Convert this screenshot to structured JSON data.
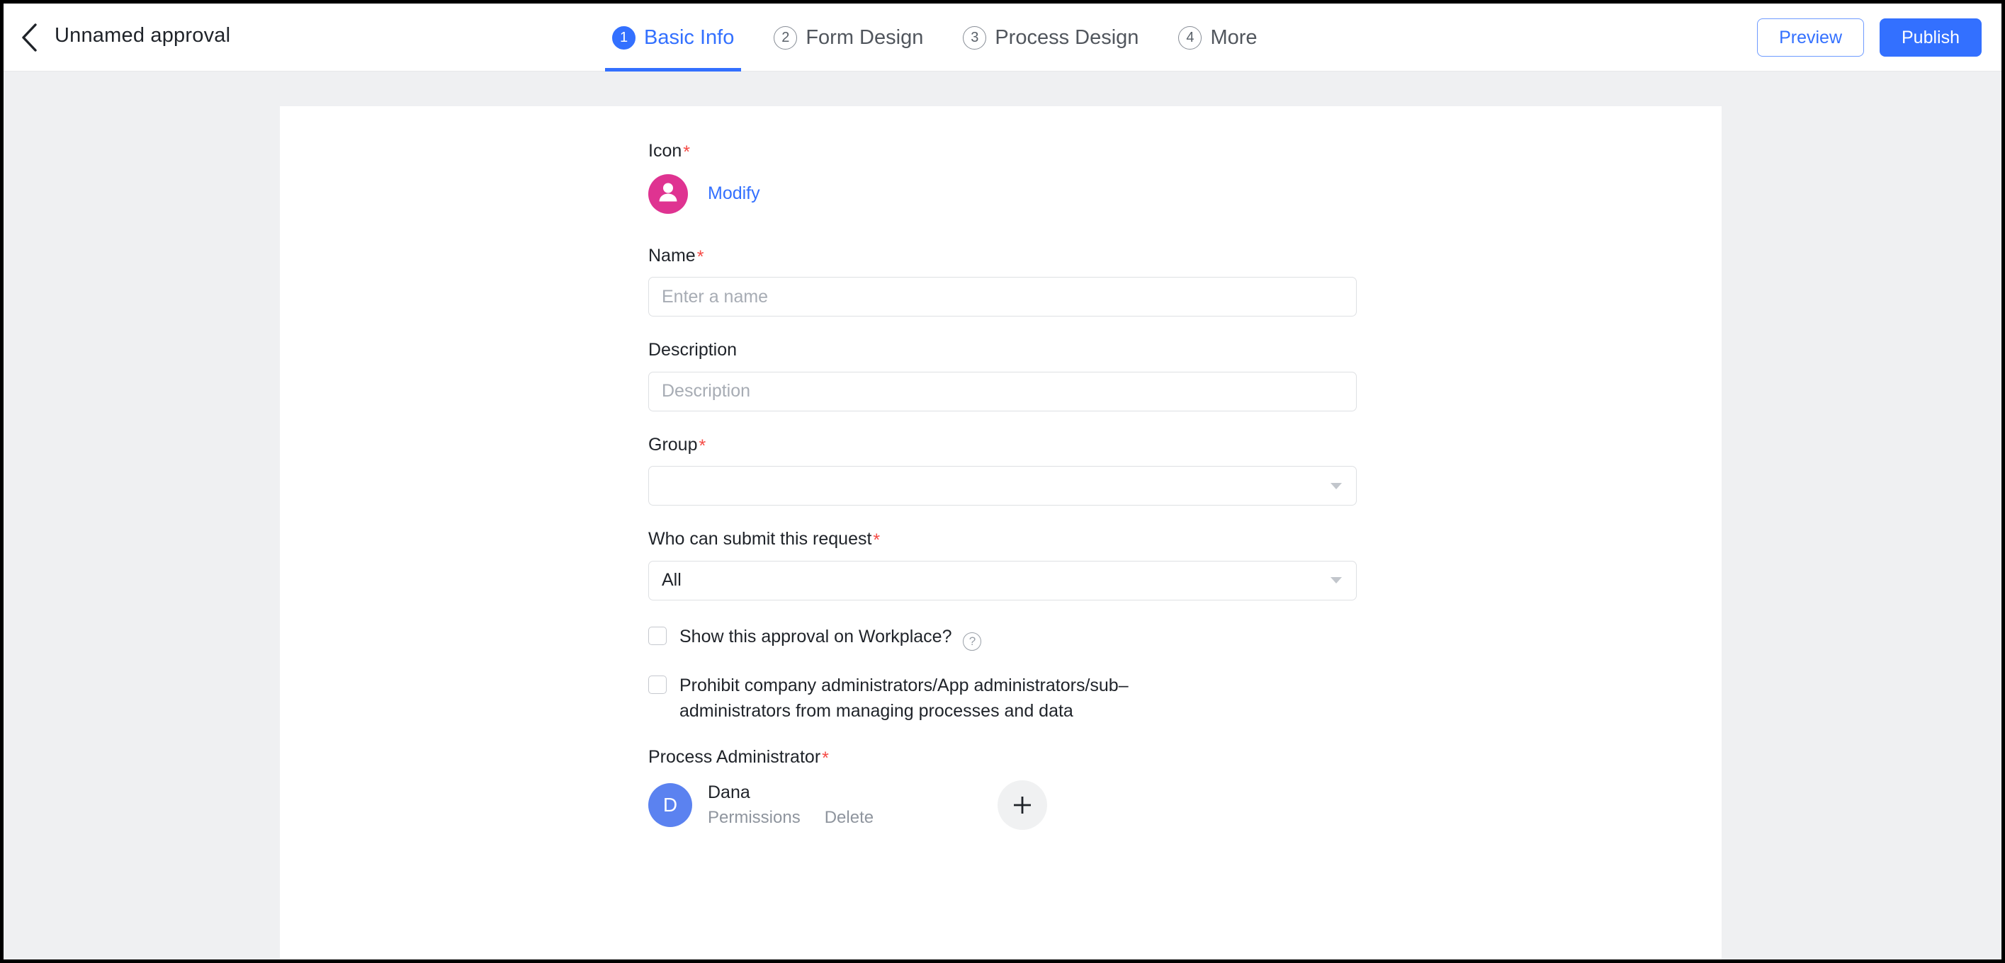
{
  "header": {
    "back_icon": "chevron-left-icon",
    "title": "Unnamed approval",
    "tabs": [
      {
        "num": "1",
        "label": "Basic Info",
        "active": true
      },
      {
        "num": "2",
        "label": "Form Design",
        "active": false
      },
      {
        "num": "3",
        "label": "Process Design",
        "active": false
      },
      {
        "num": "4",
        "label": "More",
        "active": false
      }
    ],
    "preview_label": "Preview",
    "publish_label": "Publish"
  },
  "form": {
    "icon": {
      "label": "Icon",
      "required": "*",
      "glyph": "person-icon",
      "color": "#df3391",
      "modify_label": "Modify"
    },
    "name": {
      "label": "Name",
      "required": "*",
      "value": "",
      "placeholder": "Enter a name"
    },
    "description": {
      "label": "Description",
      "value": "",
      "placeholder": "Description"
    },
    "group": {
      "label": "Group",
      "required": "*",
      "value": "",
      "placeholder": ""
    },
    "who_can_submit": {
      "label": "Who can submit this request",
      "required": "*",
      "value": "All"
    },
    "show_on_workplace": {
      "label": "Show this approval on Workplace?",
      "checked": false,
      "help_glyph": "?"
    },
    "prohibit_admins": {
      "label": "Prohibit company administrators/App administrators/sub–administrators from managing processes and data",
      "checked": false
    },
    "process_administrator": {
      "label": "Process Administrator",
      "required": "*",
      "admins": [
        {
          "initial": "D",
          "name": "Dana",
          "avatar_color": "#5b82f0",
          "permissions_label": "Permissions",
          "delete_label": "Delete"
        }
      ],
      "add_label": "+"
    }
  },
  "colors": {
    "accent": "#3370ff",
    "required": "#f54a45",
    "icon_pink": "#df3391",
    "avatar_blue": "#5b82f0",
    "page_bg": "#eff0f2"
  }
}
